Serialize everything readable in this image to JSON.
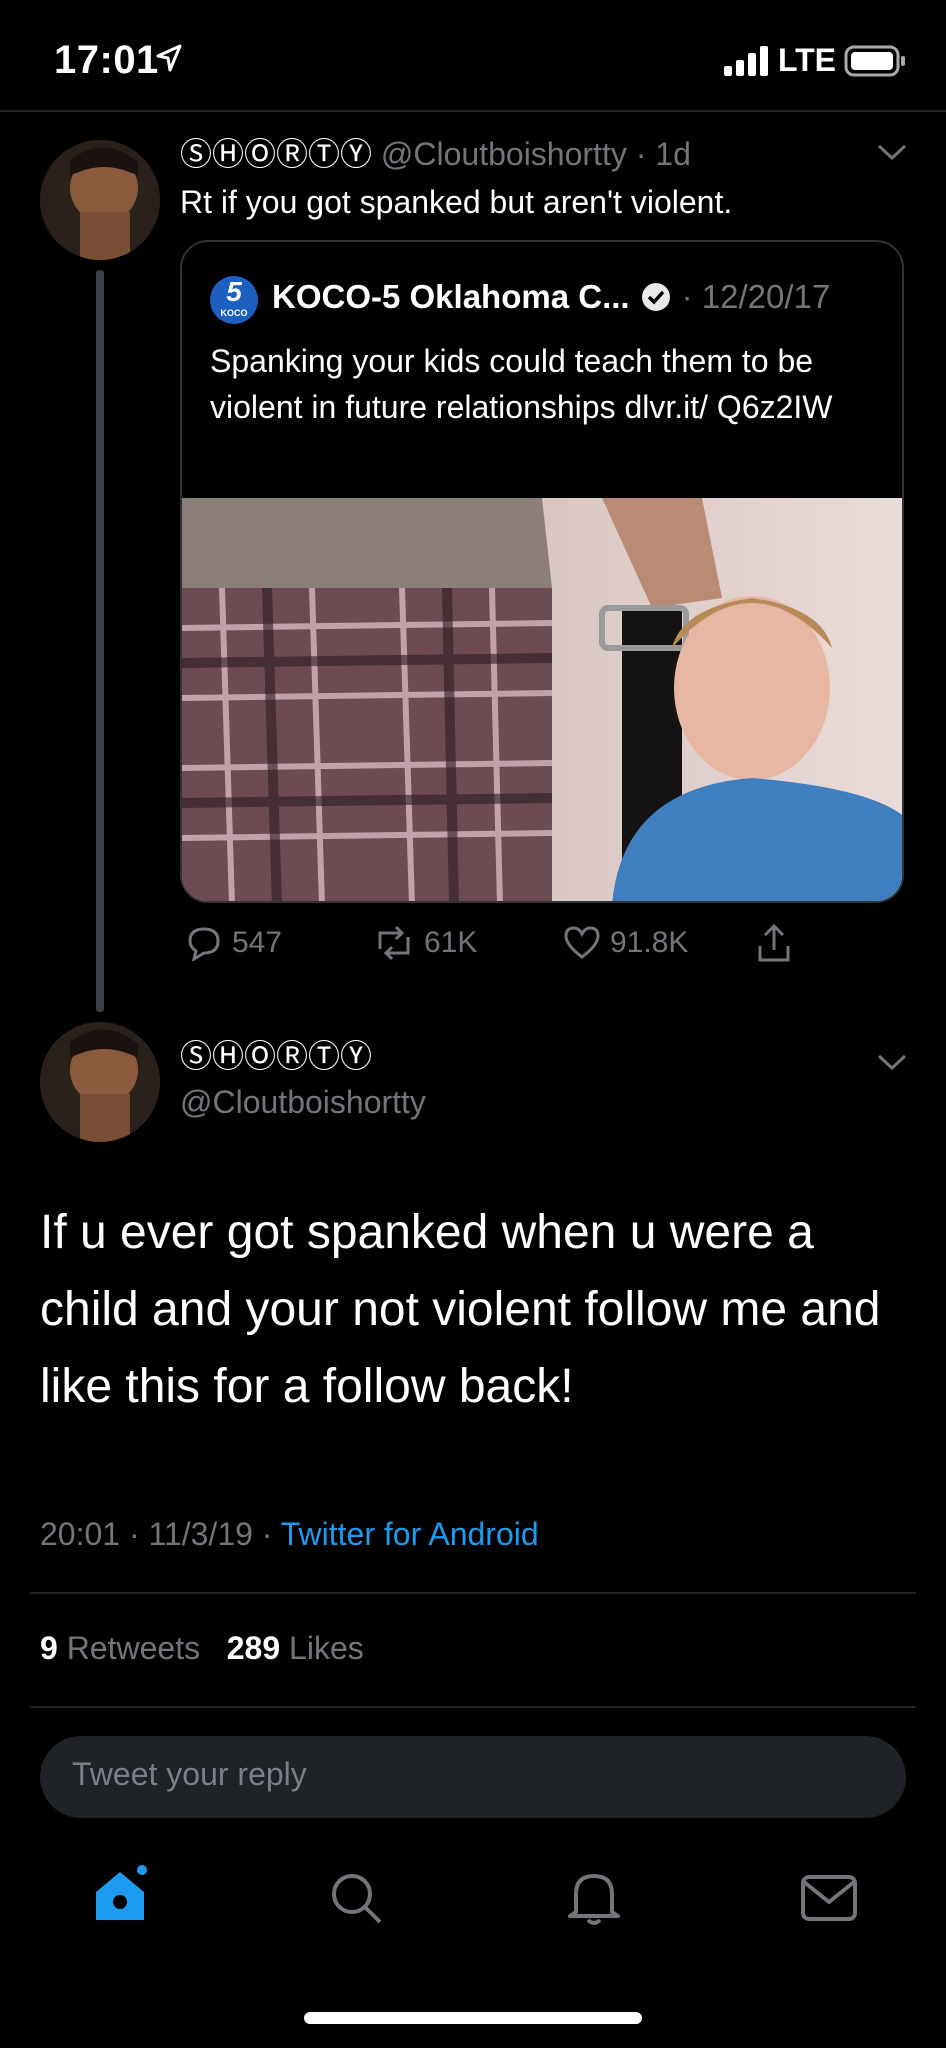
{
  "status": {
    "time": "17:01",
    "network": "LTE"
  },
  "tweet1": {
    "username": "ⓈⒽⓄⓇⓉⓎ",
    "handle": "@Cloutboishortty",
    "age": "· 1d",
    "text": "Rt if you got spanked but aren't violent.",
    "quote": {
      "name": "KOCO-5 Oklahoma C...",
      "date": "· 12/20/17",
      "text": "Spanking your kids could teach them to be violent in future relationships dlvr.it/ Q6z2IW",
      "logo_text": "5",
      "logo_sub": "KOCO"
    },
    "actions": {
      "replies": "547",
      "retweets": "61K",
      "likes": "91.8K"
    }
  },
  "tweet2": {
    "username": "ⓈⒽⓄⓇⓉⓎ",
    "handle": "@Cloutboishortty",
    "text": "If u ever got spanked when u were a child and your not violent follow me and like this for a follow back!",
    "timestamp": "20:01 · 11/3/19 · ",
    "source": "Twitter for Android",
    "retweet_count": "9",
    "retweet_label": "Retweets",
    "like_count": "289",
    "like_label": "Likes"
  },
  "reply": {
    "placeholder": "Tweet your reply"
  },
  "tabs": [
    "home-icon",
    "search-icon",
    "notifications-icon",
    "messages-icon"
  ],
  "colors": {
    "accent": "#1d9bf0",
    "background": "#000000",
    "muted": "#71767b"
  }
}
